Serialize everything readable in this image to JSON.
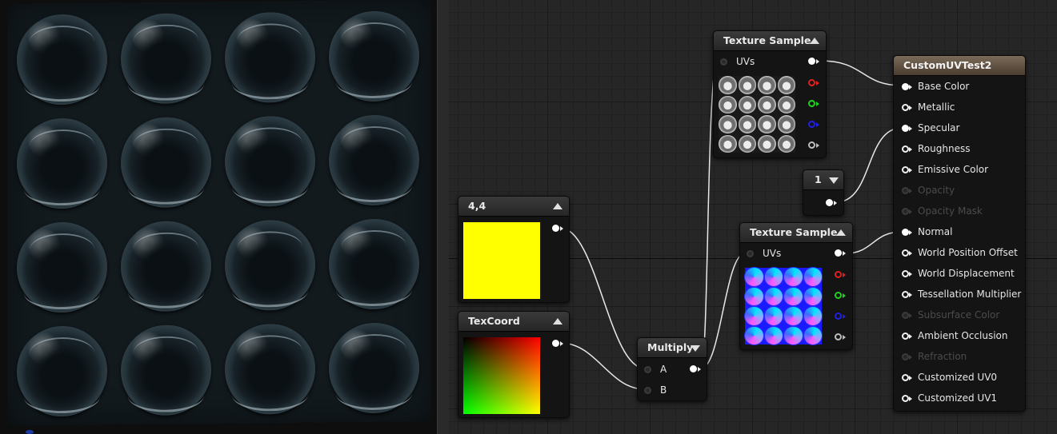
{
  "viewport": {
    "preview_bubbles": 16
  },
  "nodes": {
    "constant2": {
      "title": "4,4",
      "preview_color": "#ffff00"
    },
    "texcoord": {
      "title": "TexCoord"
    },
    "multiply": {
      "title": "Multiply",
      "input_a": "A",
      "input_b": "B"
    },
    "texture_sample_1": {
      "title": "Texture Sample",
      "uvs_label": "UVs"
    },
    "texture_sample_2": {
      "title": "Texture Sample",
      "uvs_label": "UVs"
    },
    "constant": {
      "title": "1"
    },
    "result": {
      "title": "CustomUVTest2",
      "inputs": [
        {
          "label": "Base Color",
          "state": "connected"
        },
        {
          "label": "Metallic",
          "state": "enabled"
        },
        {
          "label": "Specular",
          "state": "connected"
        },
        {
          "label": "Roughness",
          "state": "enabled"
        },
        {
          "label": "Emissive Color",
          "state": "enabled"
        },
        {
          "label": "Opacity",
          "state": "disabled"
        },
        {
          "label": "Opacity Mask",
          "state": "disabled"
        },
        {
          "label": "Normal",
          "state": "connected"
        },
        {
          "label": "World Position Offset",
          "state": "enabled"
        },
        {
          "label": "World Displacement",
          "state": "enabled"
        },
        {
          "label": "Tessellation Multiplier",
          "state": "enabled"
        },
        {
          "label": "Subsurface Color",
          "state": "disabled"
        },
        {
          "label": "Ambient Occlusion",
          "state": "enabled"
        },
        {
          "label": "Refraction",
          "state": "disabled"
        },
        {
          "label": "Customized UV0",
          "state": "enabled"
        },
        {
          "label": "Customized UV1",
          "state": "enabled"
        }
      ]
    }
  },
  "colors": {
    "graph_bg": "#262626",
    "result_header": "#6a5a48",
    "wire": "#e8e8e8",
    "channel_r": "#e02020",
    "channel_g": "#20d020",
    "channel_b": "#2020e0",
    "channel_a": "#bdbdbd"
  }
}
